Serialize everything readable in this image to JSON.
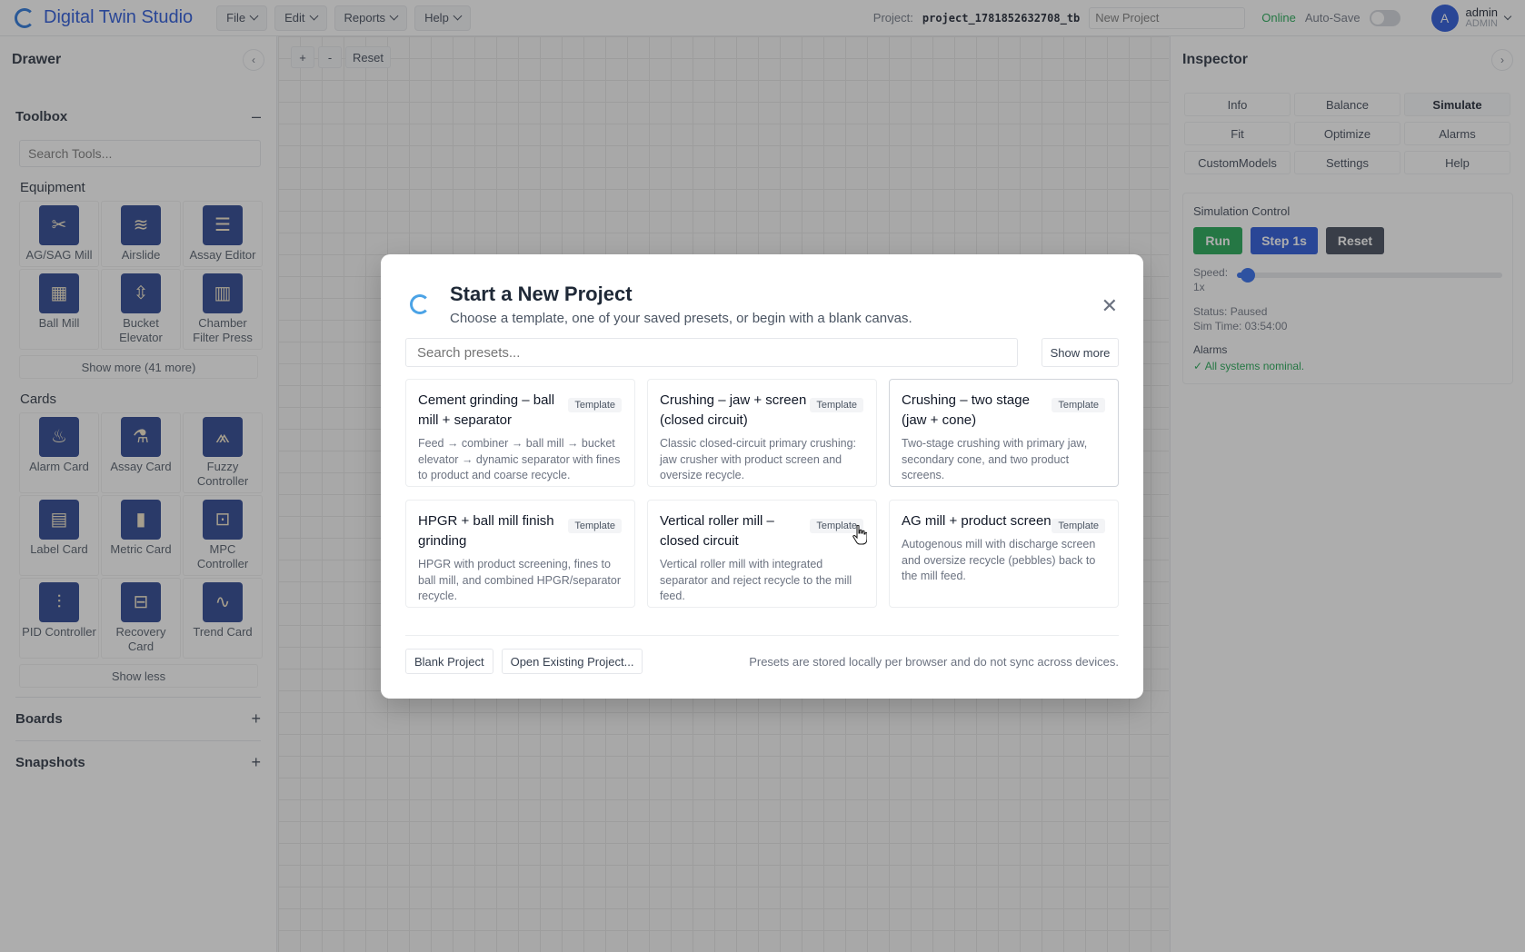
{
  "app": {
    "title": "Digital Twin Studio",
    "menus": [
      {
        "label": "File"
      },
      {
        "label": "Edit"
      },
      {
        "label": "Reports"
      },
      {
        "label": "Help"
      }
    ],
    "project_label": "Project:",
    "project_id": "project_1781852632708_tb",
    "project_name_placeholder": "New Project",
    "status": "Online",
    "autosave_label": "Auto-Save",
    "autosave_enabled": false,
    "user": {
      "initial": "A",
      "name": "admin",
      "role": "ADMIN"
    }
  },
  "drawer": {
    "title": "Drawer",
    "collapse_icon": "chevron-left-icon",
    "toolbox": {
      "title": "Toolbox",
      "toggle": "–",
      "search_placeholder": "Search Tools...",
      "equipment": {
        "label": "Equipment",
        "items": [
          {
            "label": "AG/SAG Mill",
            "icon": "mill-icon",
            "glyph": "✂"
          },
          {
            "label": "Airslide",
            "icon": "airslide-icon",
            "glyph": "≋"
          },
          {
            "label": "Assay Editor",
            "icon": "assay-editor-icon",
            "glyph": "☰"
          },
          {
            "label": "Ball Mill",
            "icon": "ball-mill-icon",
            "glyph": "▦"
          },
          {
            "label": "Bucket Elevator",
            "icon": "bucket-elevator-icon",
            "glyph": "⇳"
          },
          {
            "label": "Chamber Filter Press",
            "icon": "filter-press-icon",
            "glyph": "▥"
          }
        ],
        "show_more": "Show more (41 more)"
      },
      "cards": {
        "label": "Cards",
        "items": [
          {
            "label": "Alarm Card",
            "icon": "alarm-icon",
            "glyph": "♨"
          },
          {
            "label": "Assay Card",
            "icon": "flask-icon",
            "glyph": "⚗"
          },
          {
            "label": "Fuzzy Controller",
            "icon": "fuzzy-icon",
            "glyph": "⩕"
          },
          {
            "label": "Label Card",
            "icon": "label-icon",
            "glyph": "▤"
          },
          {
            "label": "Metric Card",
            "icon": "bar-chart-icon",
            "glyph": "▮"
          },
          {
            "label": "MPC Controller",
            "icon": "mpc-icon",
            "glyph": "⊡"
          },
          {
            "label": "PID Controller",
            "icon": "sliders-icon",
            "glyph": "⫶"
          },
          {
            "label": "Recovery Card",
            "icon": "recovery-icon",
            "glyph": "⊟"
          },
          {
            "label": "Trend Card",
            "icon": "trend-icon",
            "glyph": "∿"
          }
        ],
        "show_less": "Show less"
      }
    },
    "boards": {
      "title": "Boards",
      "toggle": "+"
    },
    "snapshots": {
      "title": "Snapshots",
      "toggle": "+"
    }
  },
  "canvas": {
    "zoom_in": "+",
    "zoom_out": "-",
    "reset": "Reset"
  },
  "inspector": {
    "title": "Inspector",
    "tabs": [
      {
        "label": "Info"
      },
      {
        "label": "Balance"
      },
      {
        "label": "Simulate"
      },
      {
        "label": "Fit"
      },
      {
        "label": "Optimize"
      },
      {
        "label": "Alarms"
      },
      {
        "label": "CustomModels"
      },
      {
        "label": "Settings"
      },
      {
        "label": "Help"
      }
    ],
    "active_tab": "Simulate",
    "simulation": {
      "title": "Simulation Control",
      "run": "Run",
      "step": "Step 1s",
      "reset": "Reset",
      "speed_label": "Speed:",
      "speed_value": "1x",
      "speed_fraction": 0.04,
      "status": "Status: Paused",
      "sim_time": "Sim Time: 03:54:00",
      "alarms_label": "Alarms",
      "alarms_status": "✓ All systems nominal."
    },
    "colors": {
      "run": "#16a34a",
      "step": "#1d4ed8",
      "reset": "#374151"
    }
  },
  "modal": {
    "title": "Start a New Project",
    "subtitle": "Choose a template, one of your saved presets, or begin with a blank canvas.",
    "search_placeholder": "Search presets...",
    "show_more": "Show more",
    "presets": [
      {
        "title": "Cement grinding – ball mill + separator",
        "badge": "Template",
        "description": "Feed → combiner → ball mill → bucket elevator → dynamic separator with fines to product and coarse recycle."
      },
      {
        "title": "Crushing – jaw + screen (closed circuit)",
        "badge": "Template",
        "description": "Classic closed-circuit primary crushing: jaw crusher with product screen and oversize recycle."
      },
      {
        "title": "Crushing – two stage (jaw + cone)",
        "badge": "Template",
        "description": "Two-stage crushing with primary jaw, secondary cone, and two product screens."
      },
      {
        "title": "HPGR + ball mill finish grinding",
        "badge": "Template",
        "description": "HPGR with product screening, fines to ball mill, and combined HPGR/separator recycle."
      },
      {
        "title": "Vertical roller mill – closed circuit",
        "badge": "Template",
        "description": "Vertical roller mill with integrated separator and reject recycle to the mill feed."
      },
      {
        "title": "AG mill + product screen",
        "badge": "Template",
        "description": "Autogenous mill with discharge screen and oversize recycle (pebbles) back to the mill feed."
      }
    ],
    "blank_project": "Blank Project",
    "open_existing": "Open Existing Project...",
    "footer_note": "Presets are stored locally per browser and do not sync across devices."
  }
}
